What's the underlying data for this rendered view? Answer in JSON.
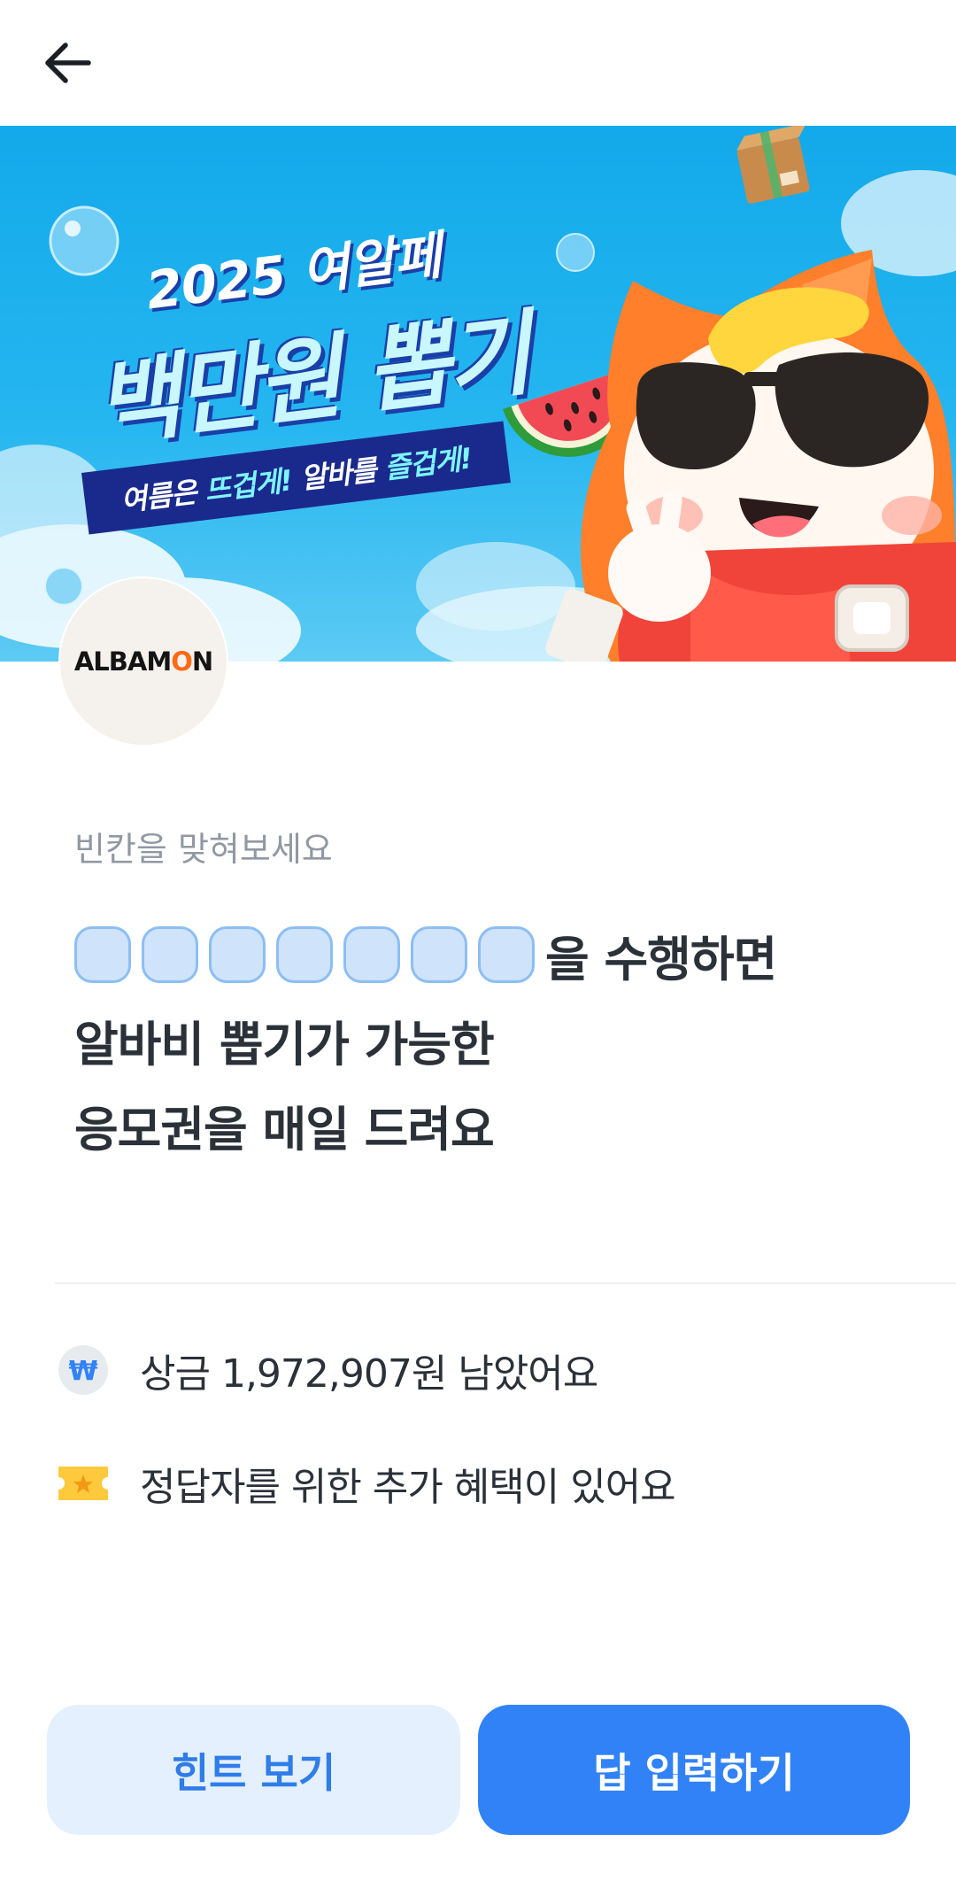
{
  "header": {
    "back_icon": "arrow-left-icon"
  },
  "banner": {
    "year": "2025 여알페",
    "title": "백만원 뽑기",
    "subtitle_a": "여름은 ",
    "subtitle_b": "뜨겁게!",
    "subtitle_c": " 알바를 ",
    "subtitle_d": "즐겁게!"
  },
  "logo": {
    "text_a": "ALBAM",
    "text_o": "O",
    "text_b": "N",
    "accent_color": "#ff6a13"
  },
  "quiz": {
    "prompt": "빈칸을 맞혀보세요",
    "blank_count": 7,
    "line1_suffix": "을 수행하면",
    "line2": "알바비 뽑기가 가능한",
    "line3": "응모권을 매일 드려요"
  },
  "info": {
    "prize_icon": "won-coin-icon",
    "prize_text": "상금 1,972,907원 남았어요",
    "benefit_icon": "ticket-icon",
    "benefit_text": "정답자를 위한 추가 혜택이 있어요"
  },
  "buttons": {
    "hint_label": "힌트 보기",
    "answer_label": "답 입력하기"
  },
  "colors": {
    "primary": "#3182f6",
    "hint_bg": "#e4f0fd",
    "blank_fill": "#cfe3fb",
    "text_dark": "#2b3139"
  }
}
